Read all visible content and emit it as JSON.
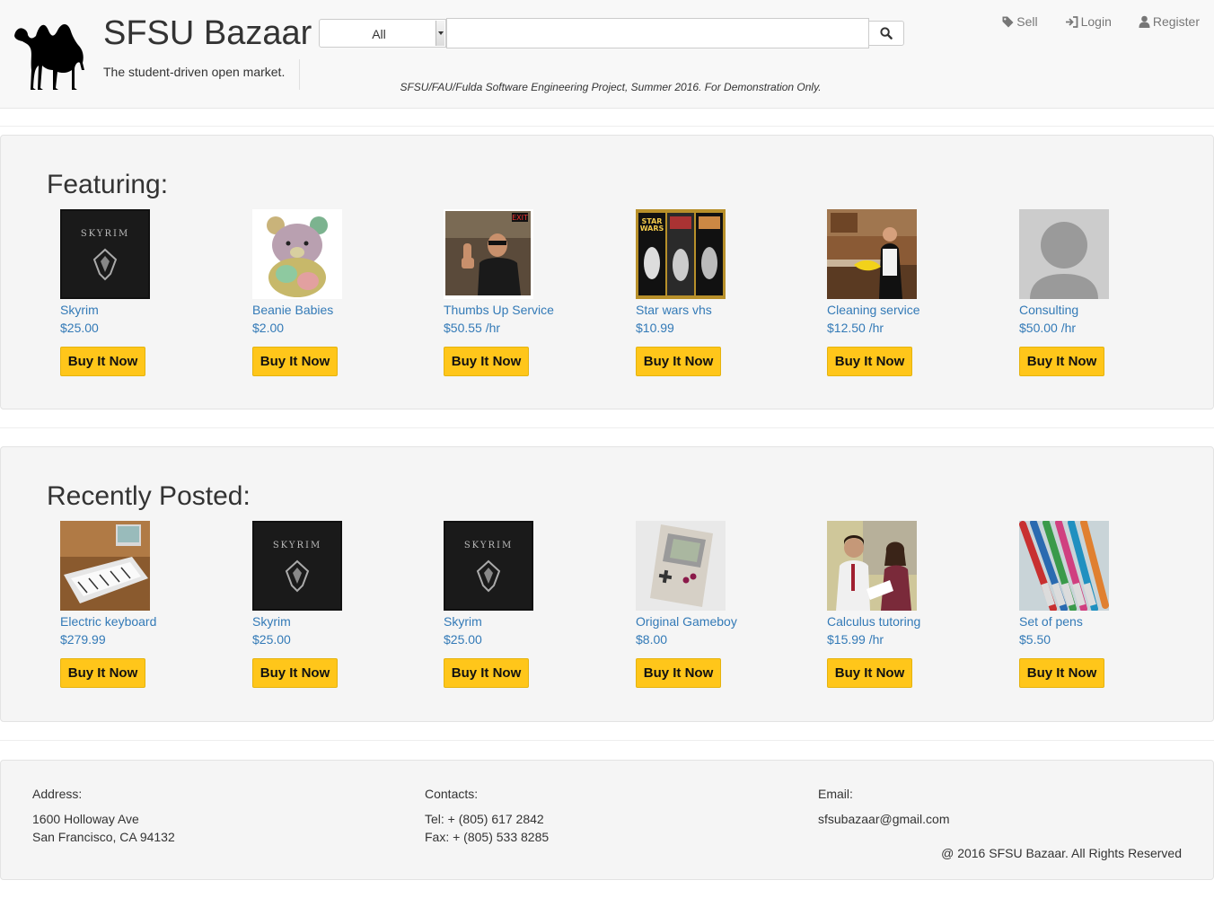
{
  "header": {
    "brand": "SFSU Bazaar",
    "tagline": "The student-driven open market.",
    "category_select": {
      "selected": "All"
    },
    "search": {
      "value": "",
      "placeholder": ""
    },
    "search_button_icon": "search-icon",
    "disclaimer": "SFSU/FAU/Fulda Software Engineering Project, Summer 2016. For Demonstration Only.",
    "nav": [
      {
        "label": "Sell",
        "icon": "tag-icon"
      },
      {
        "label": "Login",
        "icon": "login-icon"
      },
      {
        "label": "Register",
        "icon": "user-icon"
      }
    ]
  },
  "featuring": {
    "title": "Featuring:",
    "items": [
      {
        "name": "Skyrim",
        "price": "$25.00",
        "button": "Buy It Now",
        "image": "skyrim-cover"
      },
      {
        "name": "Beanie Babies",
        "price": "$2.00",
        "button": "Buy It Now",
        "image": "beanie-bear"
      },
      {
        "name": "Thumbs Up Service",
        "price": "$50.55 /hr",
        "button": "Buy It Now",
        "image": "thumbs-up-photo"
      },
      {
        "name": "Star wars vhs",
        "price": "$10.99",
        "button": "Buy It Now",
        "image": "star-wars-vhs"
      },
      {
        "name": "Cleaning service",
        "price": "$12.50 /hr",
        "button": "Buy It Now",
        "image": "cleaning-photo"
      },
      {
        "name": "Consulting",
        "price": "$50.00 /hr",
        "button": "Buy It Now",
        "image": "default-avatar"
      }
    ]
  },
  "recently_posted": {
    "title": "Recently Posted:",
    "items": [
      {
        "name": "Electric keyboard",
        "price": "$279.99",
        "button": "Buy It Now",
        "image": "keyboard-photo"
      },
      {
        "name": "Skyrim",
        "price": "$25.00",
        "button": "Buy It Now",
        "image": "skyrim-cover"
      },
      {
        "name": "Skyrim",
        "price": "$25.00",
        "button": "Buy It Now",
        "image": "skyrim-cover"
      },
      {
        "name": "Original Gameboy",
        "price": "$8.00",
        "button": "Buy It Now",
        "image": "gameboy-photo"
      },
      {
        "name": "Calculus tutoring",
        "price": "$15.99 /hr",
        "button": "Buy It Now",
        "image": "tutoring-photo"
      },
      {
        "name": "Set of pens",
        "price": "$5.50",
        "button": "Buy It Now",
        "image": "pens-photo"
      }
    ]
  },
  "footer": {
    "address_label": "Address:",
    "address_line1": "1600 Holloway Ave",
    "address_line2": "San Francisco, CA 94132",
    "contacts_label": "Contacts:",
    "tel": "Tel: + (805) 617 2842",
    "fax": "Fax: + (805) 533 8285",
    "email_label": "Email:",
    "email": "sfsubazaar@gmail.com",
    "copyright": "@ 2016 SFSU Bazaar. All Rights Reserved"
  },
  "colors": {
    "link": "#337ab7",
    "buy_button": "#ffc61a",
    "panel_bg": "#f5f5f5",
    "navbar_bg": "#f8f8f8"
  }
}
